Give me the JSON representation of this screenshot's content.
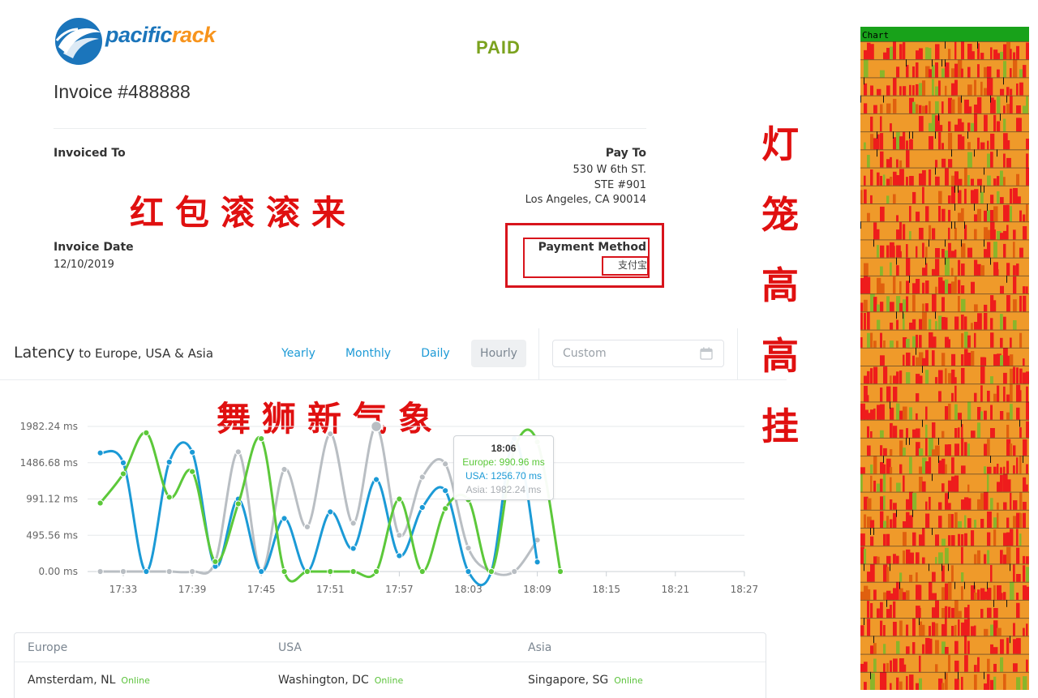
{
  "invoice": {
    "brand": {
      "part1": "pacific",
      "part2": "rack",
      "colors": {
        "blue": "#1b75bb",
        "orange": "#f7941d"
      }
    },
    "status": "PAID",
    "title": "Invoice #488888",
    "invoiced_to_label": "Invoiced To",
    "pay_to": {
      "label": "Pay To",
      "lines": [
        "530 W 6th ST.",
        "STE #901",
        "Los Angeles, CA 90014"
      ]
    },
    "invoice_date_label": "Invoice Date",
    "invoice_date": "12/10/2019",
    "payment_method_label": "Payment Method",
    "payment_method": "支付宝"
  },
  "overlay_text": {
    "greeting1": "红包滚滚来",
    "greeting2": "舞狮新气象",
    "vertical": [
      "灯",
      "笼",
      "高",
      "高",
      "挂"
    ]
  },
  "latency": {
    "title": "Latency",
    "subtitle": "to Europe, USA & Asia",
    "tabs": [
      {
        "label": "Yearly",
        "active": false
      },
      {
        "label": "Monthly",
        "active": false
      },
      {
        "label": "Daily",
        "active": false
      },
      {
        "label": "Hourly",
        "active": true
      }
    ],
    "custom_placeholder": "Custom",
    "tooltip": {
      "time": "18:06",
      "europe": "Europe: 990.96 ms",
      "usa": "USA: 1256.70 ms",
      "asia": "Asia: 1982.24 ms"
    }
  },
  "chart_data": {
    "type": "line",
    "x_labels": [
      "17:33",
      "17:39",
      "17:45",
      "17:51",
      "17:57",
      "18:03",
      "18:09",
      "18:15",
      "18:21",
      "18:27"
    ],
    "y_ticks": [
      "1982.24 ms",
      "1486.68 ms",
      "991.12 ms",
      "495.56 ms",
      "0.00 ms"
    ],
    "ylim": [
      0,
      1982.24
    ],
    "x_step_minutes": 2,
    "x_start_index": -1,
    "series": [
      {
        "name": "Europe",
        "color": "#5cc83a",
        "values": [
          935,
          1335,
          1895,
          1015,
          1365,
          135,
          925,
          1815,
          0,
          0,
          0,
          0,
          0,
          990.96,
          0,
          860,
          980,
          0,
          1665,
          1770,
          0
        ]
      },
      {
        "name": "USA",
        "color": "#1b9ad6",
        "values": [
          1620,
          1485,
          0,
          1495,
          1630,
          70,
          990,
          0,
          725,
          0,
          815,
          315,
          1256.7,
          215,
          875,
          1105,
          0,
          0,
          1815,
          130
        ]
      },
      {
        "name": "Asia",
        "color": "#b9bec3",
        "values": [
          0,
          0,
          0,
          0,
          0,
          135,
          1635,
          0,
          1395,
          610,
          1880,
          660,
          1982.24,
          495,
          1290,
          1470,
          320,
          0,
          0,
          430
        ]
      }
    ],
    "grid": true
  },
  "locations": {
    "columns": [
      {
        "region": "Europe",
        "city": "Amsterdam, NL",
        "status": "Online"
      },
      {
        "region": "USA",
        "city": "Washington, DC",
        "status": "Online"
      },
      {
        "region": "Asia",
        "city": "Singapore, SG",
        "status": "Online"
      }
    ]
  },
  "heatmap": {
    "label": "Chart",
    "colors": {
      "header": "#18a21a",
      "base": "#ef9a2a",
      "hot": "#ee1c1c",
      "mid": "#e0600f",
      "cool": "#8ab52a",
      "dark": "#111111"
    }
  }
}
